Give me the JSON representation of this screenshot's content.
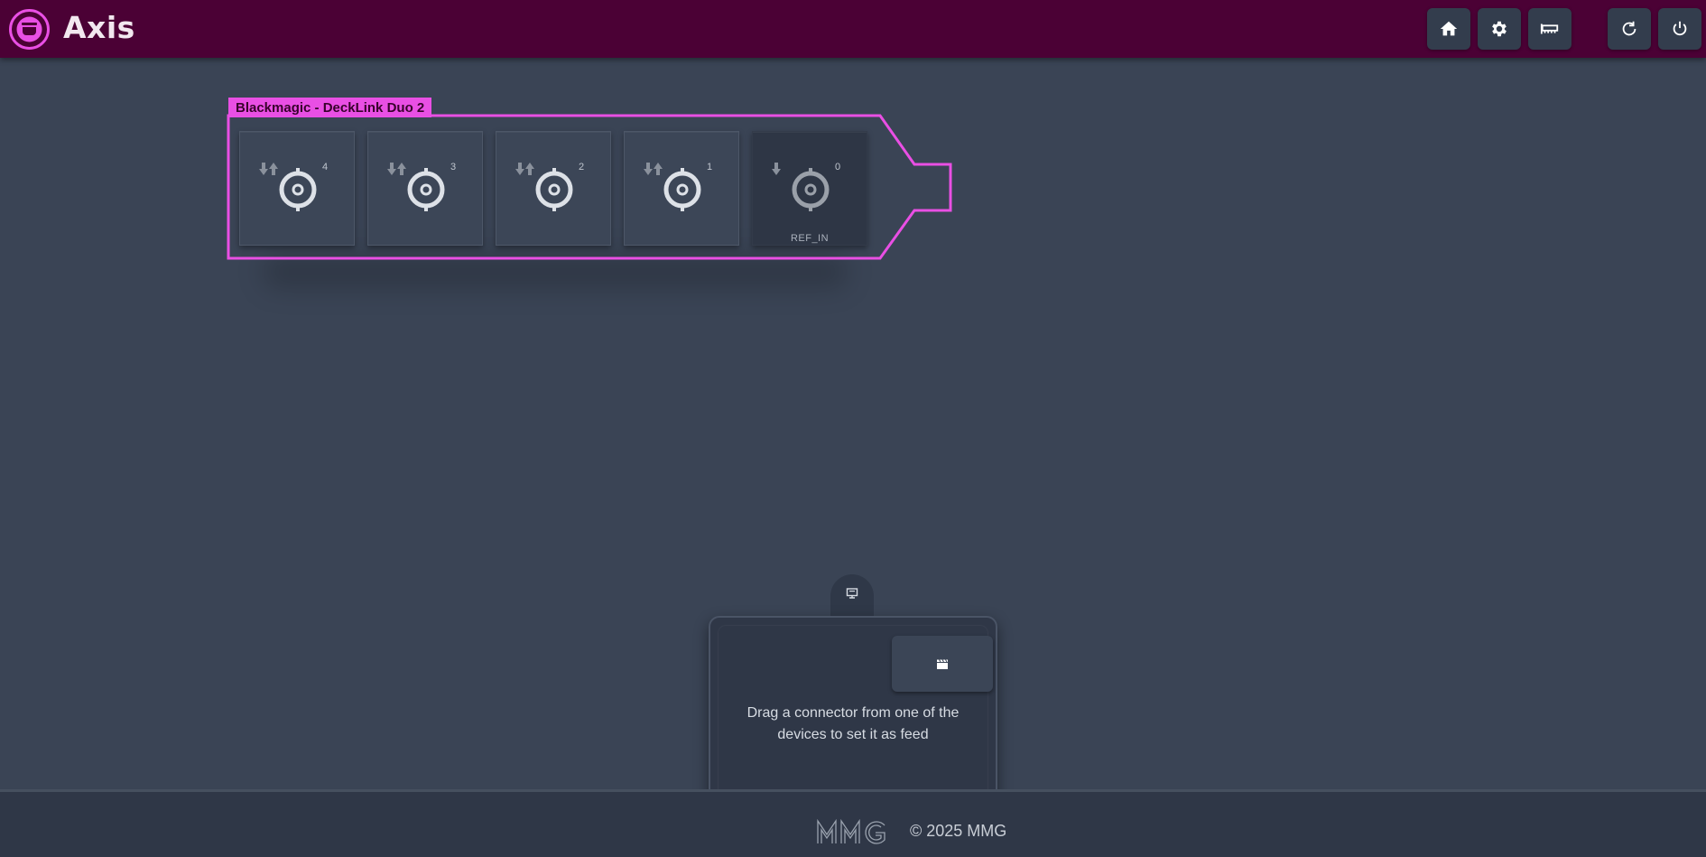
{
  "app": {
    "title": "Axis"
  },
  "colors": {
    "header_bg": "#4b0135",
    "accent": "#e94fe4",
    "background": "#3a4455",
    "panel": "#2f3747"
  },
  "header": {
    "buttons": [
      {
        "name": "home",
        "icon": "home-icon"
      },
      {
        "name": "settings",
        "icon": "gear-icon"
      },
      {
        "name": "devices",
        "icon": "pcie-card-icon"
      },
      {
        "name": "refresh",
        "icon": "refresh-icon"
      },
      {
        "name": "power",
        "icon": "power-icon"
      }
    ]
  },
  "device": {
    "label": "Blackmagic - DeckLink Duo 2",
    "ports": [
      {
        "number": "4",
        "direction": "bidirectional",
        "label": ""
      },
      {
        "number": "3",
        "direction": "bidirectional",
        "label": ""
      },
      {
        "number": "2",
        "direction": "bidirectional",
        "label": ""
      },
      {
        "number": "1",
        "direction": "bidirectional",
        "label": ""
      },
      {
        "number": "0",
        "direction": "input",
        "label": "REF_IN"
      }
    ]
  },
  "feed": {
    "tab_icon": "monitor-icon",
    "button_icon": "clapperboard-icon",
    "instruction": "Drag a connector from one of the devices to set it as feed"
  },
  "footer": {
    "logo_text": "MMG",
    "copyright": "© 2025 MMG"
  }
}
